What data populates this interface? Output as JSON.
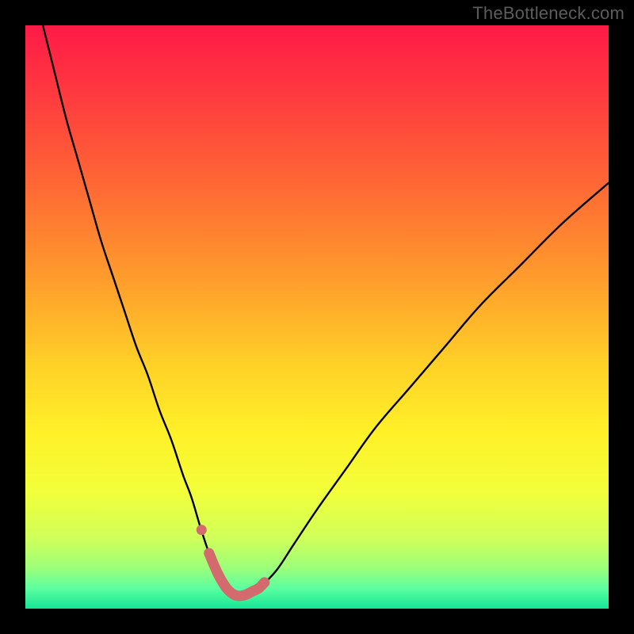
{
  "watermark": "TheBottleneck.com",
  "colors": {
    "frame": "#000000",
    "curve": "#000000",
    "marker": "#d36a6d",
    "gradient_stops": [
      {
        "offset": 0.0,
        "color": "#ff1a47"
      },
      {
        "offset": 0.12,
        "color": "#ff3a3f"
      },
      {
        "offset": 0.28,
        "color": "#ff6a34"
      },
      {
        "offset": 0.44,
        "color": "#ff9e2c"
      },
      {
        "offset": 0.58,
        "color": "#ffd028"
      },
      {
        "offset": 0.7,
        "color": "#fff128"
      },
      {
        "offset": 0.8,
        "color": "#f2ff3a"
      },
      {
        "offset": 0.88,
        "color": "#cfff5a"
      },
      {
        "offset": 0.93,
        "color": "#9dff7a"
      },
      {
        "offset": 0.965,
        "color": "#5cffa0"
      },
      {
        "offset": 1.0,
        "color": "#16e597"
      }
    ]
  },
  "chart_data": {
    "type": "line",
    "title": "",
    "xlabel": "",
    "ylabel": "",
    "xlim": [
      0,
      100
    ],
    "ylim": [
      0,
      100
    ],
    "series": [
      {
        "name": "bottleneck-curve",
        "x": [
          3,
          5,
          7,
          9,
          11,
          13,
          15,
          17,
          19,
          21,
          23,
          25,
          27,
          28.5,
          30,
          31.5,
          33,
          34.5,
          36,
          38,
          40,
          43,
          46,
          50,
          55,
          60,
          66,
          72,
          78,
          85,
          92,
          100
        ],
        "y": [
          100,
          92,
          84,
          77,
          70,
          63,
          57,
          51,
          45,
          40,
          34,
          29,
          23,
          19,
          14,
          9.5,
          6,
          3.5,
          2.3,
          2.3,
          3.5,
          6.5,
          11,
          17,
          24,
          31,
          38,
          45,
          52,
          59,
          66,
          73
        ]
      }
    ],
    "markers": {
      "name": "highlight-region",
      "x": [
        30.2,
        31.5,
        33,
        34.5,
        36,
        37.5,
        39,
        40,
        41
      ],
      "y": [
        13.5,
        9.5,
        6,
        3.5,
        2.3,
        2.3,
        3,
        3.5,
        4.5
      ]
    }
  }
}
